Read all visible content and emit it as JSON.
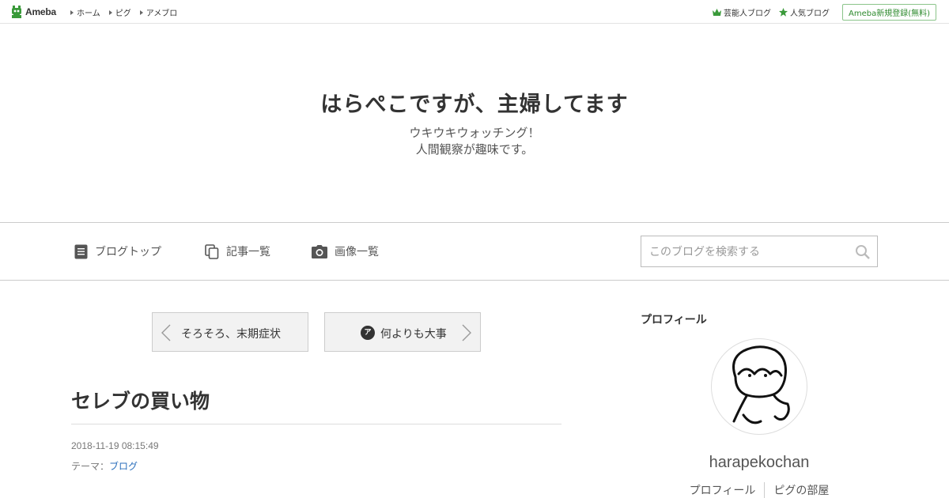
{
  "topbar": {
    "logo_text": "Ameba",
    "nav": [
      "ホーム",
      "ピグ",
      "アメブロ"
    ],
    "celebrity_blog": "芸能人ブログ",
    "popular_blog": "人気ブログ",
    "register": "Ameba新規登録(無料)",
    "icons": {
      "celebrity": "crown-icon",
      "popular": "star-icon"
    },
    "colors": {
      "accent": "#2d8a2d",
      "icon_green": "#3a9a3a"
    }
  },
  "header": {
    "title": "はらぺこですが、主婦してます",
    "desc_line1": "ウキウキウォッチング！",
    "desc_line2": "人間観察が趣味です。"
  },
  "nav": {
    "blog_top": "ブログトップ",
    "entry_list": "記事一覧",
    "image_list": "画像一覧",
    "search_placeholder": "このブログを検索する"
  },
  "pager": {
    "prev": "そろそろ、末期症状",
    "next": "何よりも大事",
    "badge": "ア"
  },
  "entry": {
    "title": "セレブの買い物",
    "date": "2018-11-19 08:15:49",
    "theme_label": "テーマ：",
    "theme_value": "ブログ",
    "theme_color": "#2a6ebb"
  },
  "sidebar": {
    "heading": "プロフィール",
    "username": "harapekochan",
    "links": [
      "プロフィール",
      "ピグの部屋"
    ]
  }
}
